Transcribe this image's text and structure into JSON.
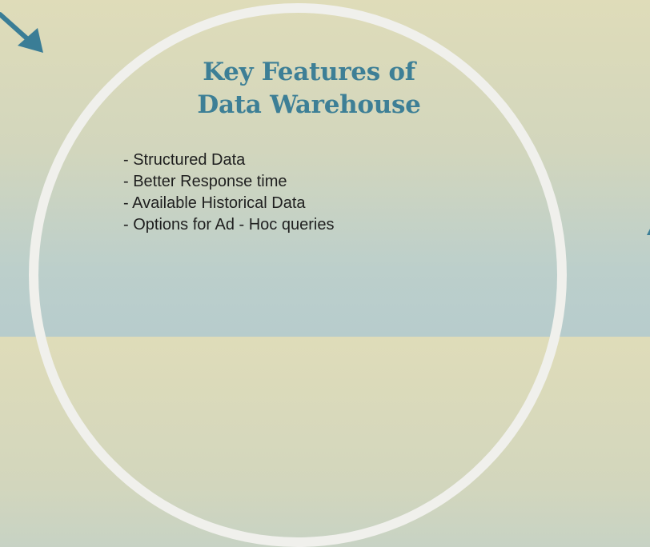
{
  "slide": {
    "title_line1": "Key Features of",
    "title_line2": "Data Warehouse",
    "bullets": [
      "- Structured Data",
      "- Better Response time",
      "- Available Historical Data",
      "- Options for Ad - Hoc queries"
    ]
  },
  "colors": {
    "title": "#3d7f96",
    "arrow": "#3a7d96",
    "ring": "#f0f0ec",
    "text": "#1f1f1f"
  },
  "icons": {
    "top_left": "arrow-down-right-icon",
    "right_edge": "arrow-fragment-icon"
  }
}
